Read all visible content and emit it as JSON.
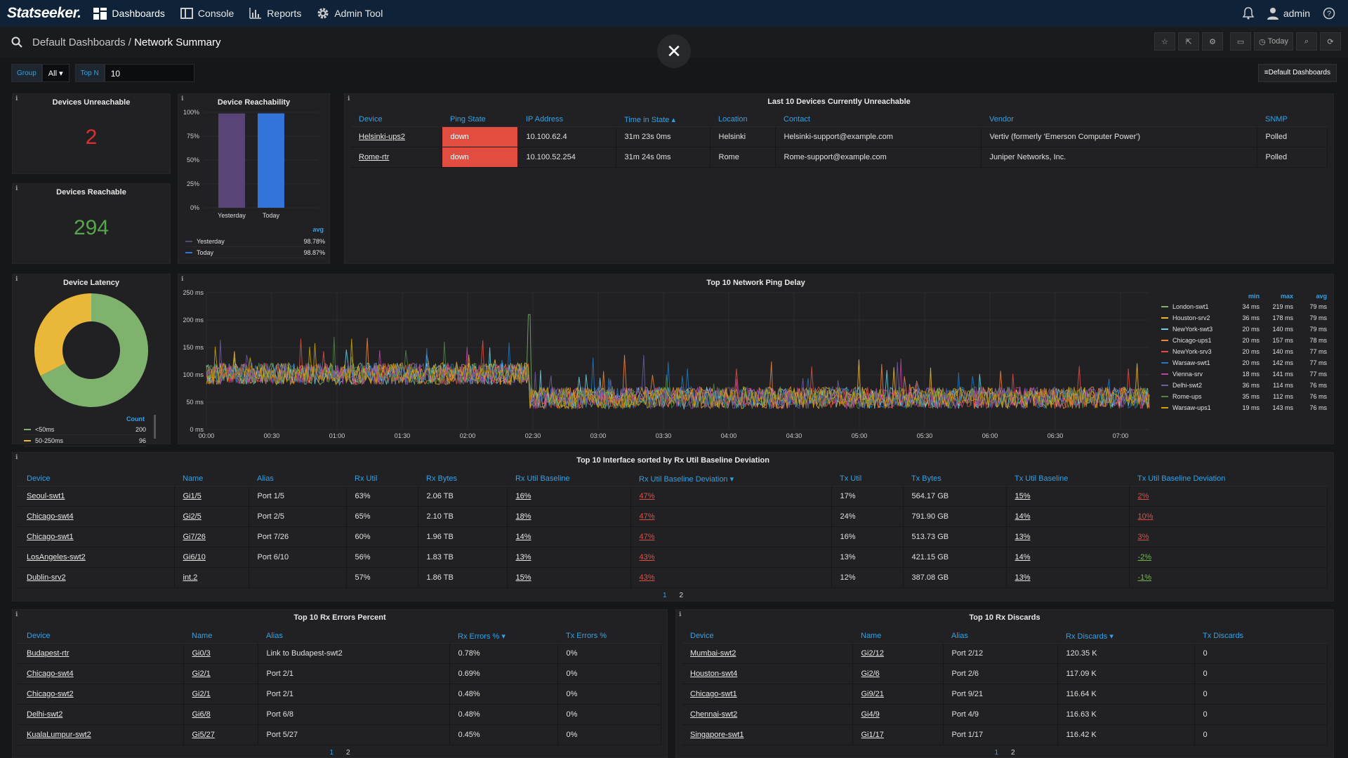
{
  "app": {
    "logo": "Statseeker."
  },
  "nav": [
    {
      "label": "Dashboards",
      "icon": "dashboard-grid-icon"
    },
    {
      "label": "Console",
      "icon": "console-icon"
    },
    {
      "label": "Reports",
      "icon": "reports-bar-icon"
    },
    {
      "label": "Admin Tool",
      "icon": "gear-icon"
    }
  ],
  "user": {
    "name": "admin"
  },
  "breadcrumb": {
    "parent": "Default Dashboards",
    "sep": " / ",
    "current": "Network Summary"
  },
  "toolbar": {
    "today_label": "Today"
  },
  "filters": {
    "group_label": "Group",
    "group_value": "All",
    "topn_label": "Top N",
    "topn_value": "10",
    "default_dashboards": "Default Dashboards"
  },
  "panels": {
    "unreachable": {
      "title": "Devices Unreachable",
      "value": "2",
      "color": "#e02f2f"
    },
    "reachable": {
      "title": "Devices Reachable",
      "value": "294",
      "color": "#56a64b"
    },
    "reachability": {
      "title": "Device Reachability",
      "avg_label": "avg"
    },
    "latency": {
      "title": "Device Latency",
      "count_label": "Count"
    },
    "ping": {
      "title": "Top 10 Network Ping Delay",
      "hdr_min": "min",
      "hdr_max": "max",
      "hdr_avg": "avg"
    },
    "last10": {
      "title": "Last 10 Devices Currently Unreachable"
    },
    "rxutil": {
      "title": "Top 10 Interface sorted by Rx Util Baseline Deviation"
    },
    "rxerr": {
      "title": "Top 10 Rx Errors Percent"
    },
    "rxdisc": {
      "title": "Top 10 Rx Discards"
    }
  },
  "unreachable_table": {
    "headers": [
      "Device",
      "Ping State",
      "IP Address",
      "Time in State ▴",
      "Location",
      "Contact",
      "Vendor",
      "SNMP"
    ],
    "rows": [
      [
        "Helsinki-ups2",
        "down",
        "10.100.62.4",
        "31m 23s 0ms",
        "Helsinki",
        "Helsinki-support@example.com",
        "Vertiv (formerly 'Emerson Computer Power')",
        "Polled"
      ],
      [
        "Rome-rtr",
        "down",
        "10.100.52.254",
        "31m 24s 0ms",
        "Rome",
        "Rome-support@example.com",
        "Juniper Networks, Inc.",
        "Polled"
      ]
    ]
  },
  "rxutil_table": {
    "headers": [
      "Device",
      "Name",
      "Alias",
      "Rx Util",
      "Rx Bytes",
      "Rx Util Baseline",
      "Rx Util Baseline Deviation ▾",
      "Tx Util",
      "Tx Bytes",
      "Tx Util Baseline",
      "Tx Util Baseline Deviation"
    ],
    "rows": [
      [
        "Seoul-swt1",
        "Gi1/5",
        "Port 1/5",
        "63%",
        "2.06 TB",
        "16%",
        "47%",
        "17%",
        "564.17 GB",
        "15%",
        "2%"
      ],
      [
        "Chicago-swt4",
        "Gi2/5",
        "Port 2/5",
        "65%",
        "2.10 TB",
        "18%",
        "47%",
        "24%",
        "791.90 GB",
        "14%",
        "10%"
      ],
      [
        "Chicago-swt1",
        "Gi7/26",
        "Port 7/26",
        "60%",
        "1.96 TB",
        "14%",
        "47%",
        "16%",
        "513.73 GB",
        "13%",
        "3%"
      ],
      [
        "LosAngeles-swt2",
        "Gi6/10",
        "Port 6/10",
        "56%",
        "1.83 TB",
        "13%",
        "43%",
        "13%",
        "421.15 GB",
        "14%",
        "-2%"
      ],
      [
        "Dublin-srv2",
        "int.2",
        "",
        "57%",
        "1.86 TB",
        "15%",
        "43%",
        "12%",
        "387.08 GB",
        "13%",
        "-1%"
      ]
    ],
    "pages": [
      "1",
      "2"
    ]
  },
  "rxerr_table": {
    "headers": [
      "Device",
      "Name",
      "Alias",
      "Rx Errors % ▾",
      "Tx Errors %"
    ],
    "rows": [
      [
        "Budapest-rtr",
        "Gi0/3",
        "Link to Budapest-swt2",
        "0.78%",
        "0%"
      ],
      [
        "Chicago-swt4",
        "Gi2/1",
        "Port 2/1",
        "0.69%",
        "0%"
      ],
      [
        "Chicago-swt2",
        "Gi2/1",
        "Port 2/1",
        "0.48%",
        "0%"
      ],
      [
        "Delhi-swt2",
        "Gi6/8",
        "Port 6/8",
        "0.48%",
        "0%"
      ],
      [
        "KualaLumpur-swt2",
        "Gi5/27",
        "Port 5/27",
        "0.45%",
        "0%"
      ]
    ],
    "pages": [
      "1",
      "2"
    ]
  },
  "rxdisc_table": {
    "headers": [
      "Device",
      "Name",
      "Alias",
      "Rx Discards ▾",
      "Tx Discards"
    ],
    "rows": [
      [
        "Mumbai-swt2",
        "Gi2/12",
        "Port 2/12",
        "120.35 K",
        "0"
      ],
      [
        "Houston-swt4",
        "Gi2/6",
        "Port 2/6",
        "117.09 K",
        "0"
      ],
      [
        "Chicago-swt1",
        "Gi9/21",
        "Port 9/21",
        "116.64 K",
        "0"
      ],
      [
        "Chennai-swt2",
        "Gi4/9",
        "Port 4/9",
        "116.63 K",
        "0"
      ],
      [
        "Singapore-swt1",
        "Gi1/17",
        "Port 1/17",
        "116.42 K",
        "0"
      ]
    ],
    "pages": [
      "1",
      "2"
    ]
  },
  "chart_data": [
    {
      "type": "bar",
      "title": "Device Reachability",
      "categories": [
        "Yesterday",
        "Today"
      ],
      "values": [
        98.78,
        98.87
      ],
      "colors": [
        "#584477",
        "#3274d9"
      ],
      "ylim": [
        0,
        100
      ],
      "yticks": [
        "0%",
        "25%",
        "50%",
        "75%",
        "100%"
      ],
      "legend": [
        {
          "name": "Yesterday",
          "avg": "98.78%"
        },
        {
          "name": "Today",
          "avg": "98.87%"
        }
      ]
    },
    {
      "type": "pie",
      "title": "Device Latency",
      "slices": [
        {
          "label": "<50ms",
          "value": 200,
          "color": "#7eb26d"
        },
        {
          "label": "50-250ms",
          "value": 96,
          "color": "#eab839"
        }
      ]
    },
    {
      "type": "line",
      "title": "Top 10 Network Ping Delay",
      "yticks": [
        "0 ms",
        "50 ms",
        "100 ms",
        "150 ms",
        "200 ms",
        "250 ms"
      ],
      "ylim": [
        0,
        250
      ],
      "xticks": [
        "00:00",
        "00:30",
        "01:00",
        "01:30",
        "02:00",
        "02:30",
        "03:00",
        "03:30",
        "04:00",
        "04:30",
        "05:00",
        "05:30",
        "06:00",
        "06:30",
        "07:00"
      ],
      "grid": true,
      "legend_position": "right",
      "series": [
        {
          "name": "London-swt1",
          "min": "34 ms",
          "max": "219 ms",
          "avg": "79 ms",
          "color": "#7eb26d"
        },
        {
          "name": "Houston-srv2",
          "min": "36 ms",
          "max": "178 ms",
          "avg": "79 ms",
          "color": "#eab839"
        },
        {
          "name": "NewYork-swt3",
          "min": "20 ms",
          "max": "140 ms",
          "avg": "79 ms",
          "color": "#6ed0e0"
        },
        {
          "name": "Chicago-ups1",
          "min": "20 ms",
          "max": "157 ms",
          "avg": "78 ms",
          "color": "#ef843c"
        },
        {
          "name": "NewYork-srv3",
          "min": "20 ms",
          "max": "140 ms",
          "avg": "77 ms",
          "color": "#e24d42"
        },
        {
          "name": "Warsaw-swt1",
          "min": "20 ms",
          "max": "142 ms",
          "avg": "77 ms",
          "color": "#1f78c1"
        },
        {
          "name": "Vienna-srv",
          "min": "18 ms",
          "max": "141 ms",
          "avg": "77 ms",
          "color": "#ba43a9"
        },
        {
          "name": "Delhi-swt2",
          "min": "36 ms",
          "max": "114 ms",
          "avg": "76 ms",
          "color": "#705da0"
        },
        {
          "name": "Rome-ups",
          "min": "35 ms",
          "max": "112 ms",
          "avg": "76 ms",
          "color": "#508642"
        },
        {
          "name": "Warsaw-ups1",
          "min": "19 ms",
          "max": "143 ms",
          "avg": "76 ms",
          "color": "#cca300"
        }
      ]
    }
  ]
}
